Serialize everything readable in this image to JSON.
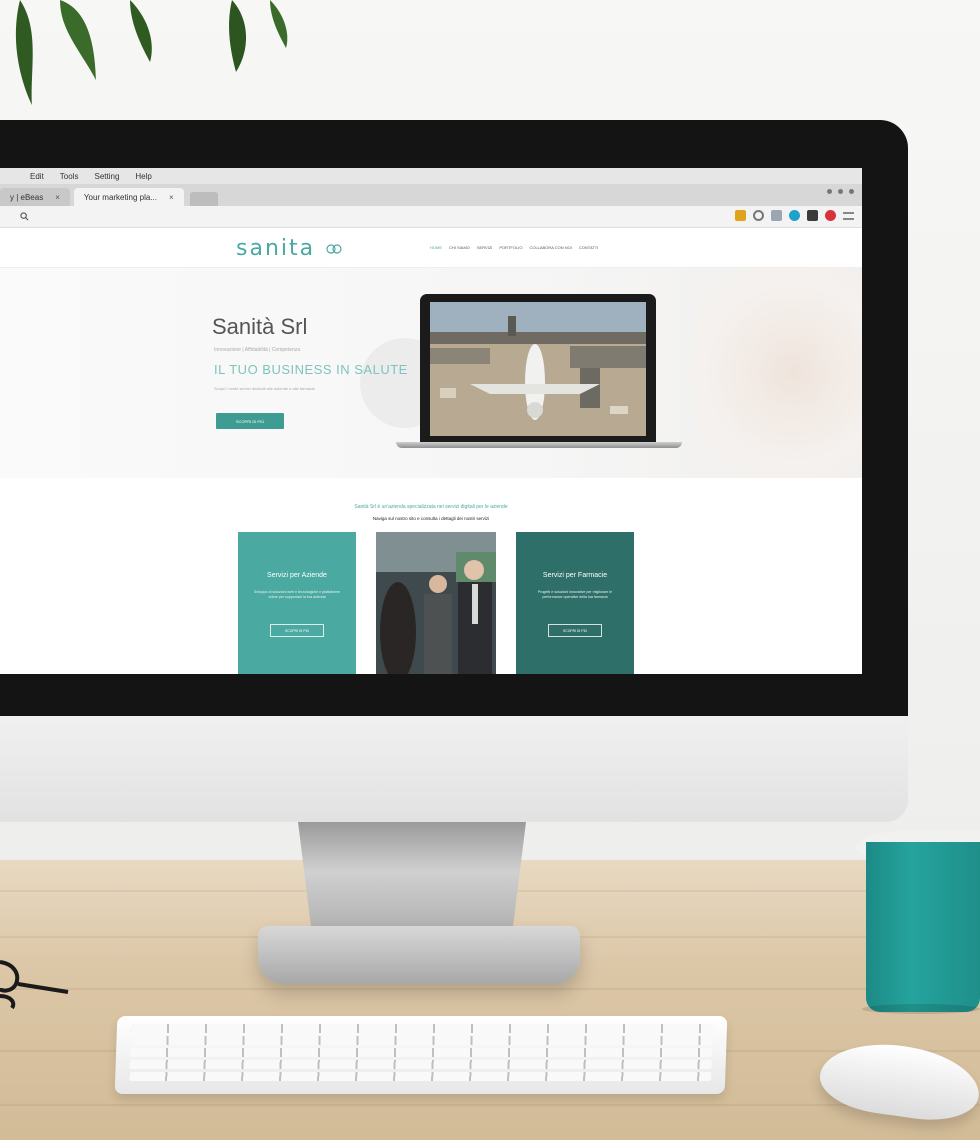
{
  "browser": {
    "menu": [
      "Edit",
      "Tools",
      "Setting",
      "Help"
    ],
    "tabs": [
      {
        "label": "y | eBeas"
      },
      {
        "label": "Your marketing pla..."
      }
    ],
    "tab_close_glyph": "×",
    "address_search_icon": "search-icon",
    "extensions": [
      {
        "icon": "star-icon",
        "color": "#e0a31d"
      },
      {
        "icon": "reload-icon",
        "color": "#777777"
      },
      {
        "icon": "feed-icon",
        "color": "#9aa7b3"
      },
      {
        "icon": "circle-icon",
        "color": "#21a1c9"
      },
      {
        "icon": "square-icon",
        "color": "#3a3a3a"
      },
      {
        "icon": "record-icon",
        "color": "#d8333c"
      },
      {
        "icon": "menu-icon",
        "color": "#888888"
      }
    ]
  },
  "site": {
    "logo": "sanita",
    "nav": [
      "HOME",
      "CHI SIAMO",
      "SERVIZI",
      "PORTFOLIO",
      "COLLABORA CON NOI",
      "CONTATTI"
    ],
    "hero": {
      "title": "Sanità Srl",
      "sub": "Innovazione | Affidabilità | Competenza",
      "headline": "IL TUO BUSINESS IN SALUTE",
      "desc": "Scopri i nostri servizi dedicati alle aziende e alle farmacie",
      "button": "SCOPRI DI PIÙ"
    },
    "intro": "Sanità Srl è un'azienda specializzata nei servizi digitali per le aziende",
    "intro_sub": "Naviga sul nostro sito e consulta i dettagli dei nostri servizi",
    "cards": [
      {
        "title": "Servizi per Aziende",
        "desc": "Sviluppo di soluzioni web e tecnologiche e piattaforme online per supportare la tua azienda",
        "button": "SCOPRI DI PIÙ"
      },
      {
        "title": "Servizi per Farmacie",
        "desc": "Progetti e soluzioni innovative per migliorare le performance operative della tua farmacia",
        "button": "SCOPRI DI PIÙ"
      }
    ]
  },
  "colors": {
    "brand_teal": "#4aa9a0",
    "dark_teal": "#2f6f69",
    "mug_teal": "#25a39d"
  }
}
